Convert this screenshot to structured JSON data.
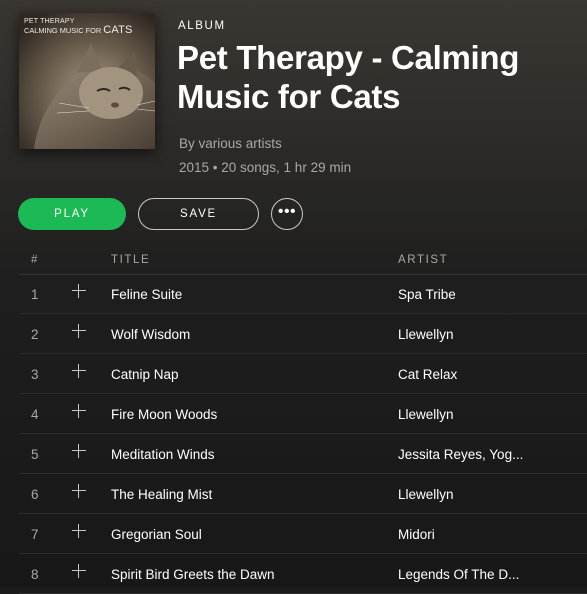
{
  "album": {
    "type_label": "ALBUM",
    "title": "Pet Therapy - Calming Music for Cats",
    "byline": "By various artists",
    "meta": "2015 • 20 songs, 1 hr 29 min",
    "cover": {
      "line1": "PET THERAPY",
      "line2_small": "CALMING MUSIC FOR ",
      "line2_big": "CATS"
    }
  },
  "actions": {
    "play_label": "PLAY",
    "save_label": "SAVE",
    "more_label": "•••"
  },
  "table": {
    "headers": {
      "num": "#",
      "title": "TITLE",
      "artist": "ARTIST"
    },
    "rows": [
      {
        "num": "1",
        "title": "Feline Suite",
        "artist": "Spa Tribe"
      },
      {
        "num": "2",
        "title": "Wolf Wisdom",
        "artist": "Llewellyn"
      },
      {
        "num": "3",
        "title": "Catnip Nap",
        "artist": "Cat Relax"
      },
      {
        "num": "4",
        "title": "Fire Moon Woods",
        "artist": "Llewellyn"
      },
      {
        "num": "5",
        "title": "Meditation Winds",
        "artist": "Jessita Reyes, Yog..."
      },
      {
        "num": "6",
        "title": "The Healing Mist",
        "artist": "Llewellyn"
      },
      {
        "num": "7",
        "title": "Gregorian Soul",
        "artist": "Midori"
      },
      {
        "num": "8",
        "title": "Spirit Bird Greets the Dawn",
        "artist": "Legends Of The D..."
      }
    ]
  },
  "colors": {
    "accent": "#1db954",
    "text_secondary": "#a8a8a8",
    "background": "#181818"
  }
}
